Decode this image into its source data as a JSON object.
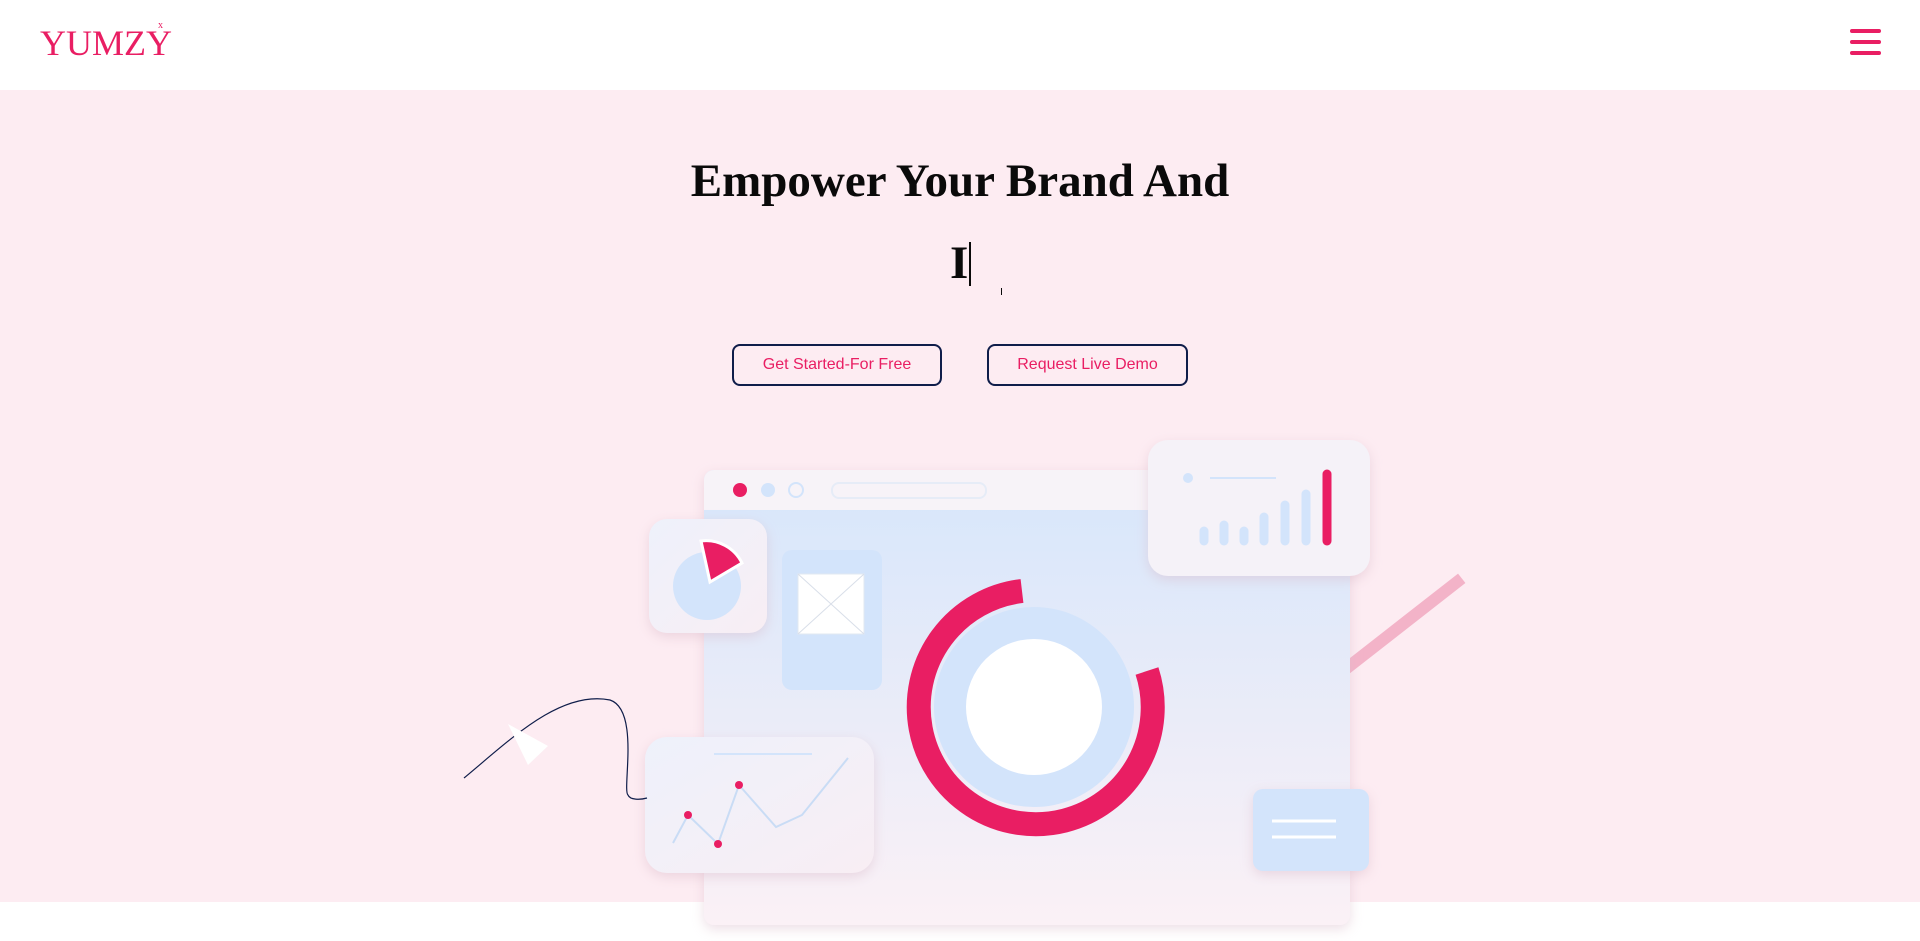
{
  "brand": {
    "name": "YUMZY",
    "mark": "x"
  },
  "hero": {
    "headline": "Empower Your Brand And",
    "typed_text": "I",
    "buttons": {
      "get_started": "Get Started-For Free",
      "live_demo": "Request Live Demo"
    }
  },
  "icons": {
    "menu": "hamburger-menu-icon"
  },
  "colors": {
    "accent": "#e91e63",
    "hero_background": "#fdecf2",
    "button_border": "#0f1d4a"
  }
}
